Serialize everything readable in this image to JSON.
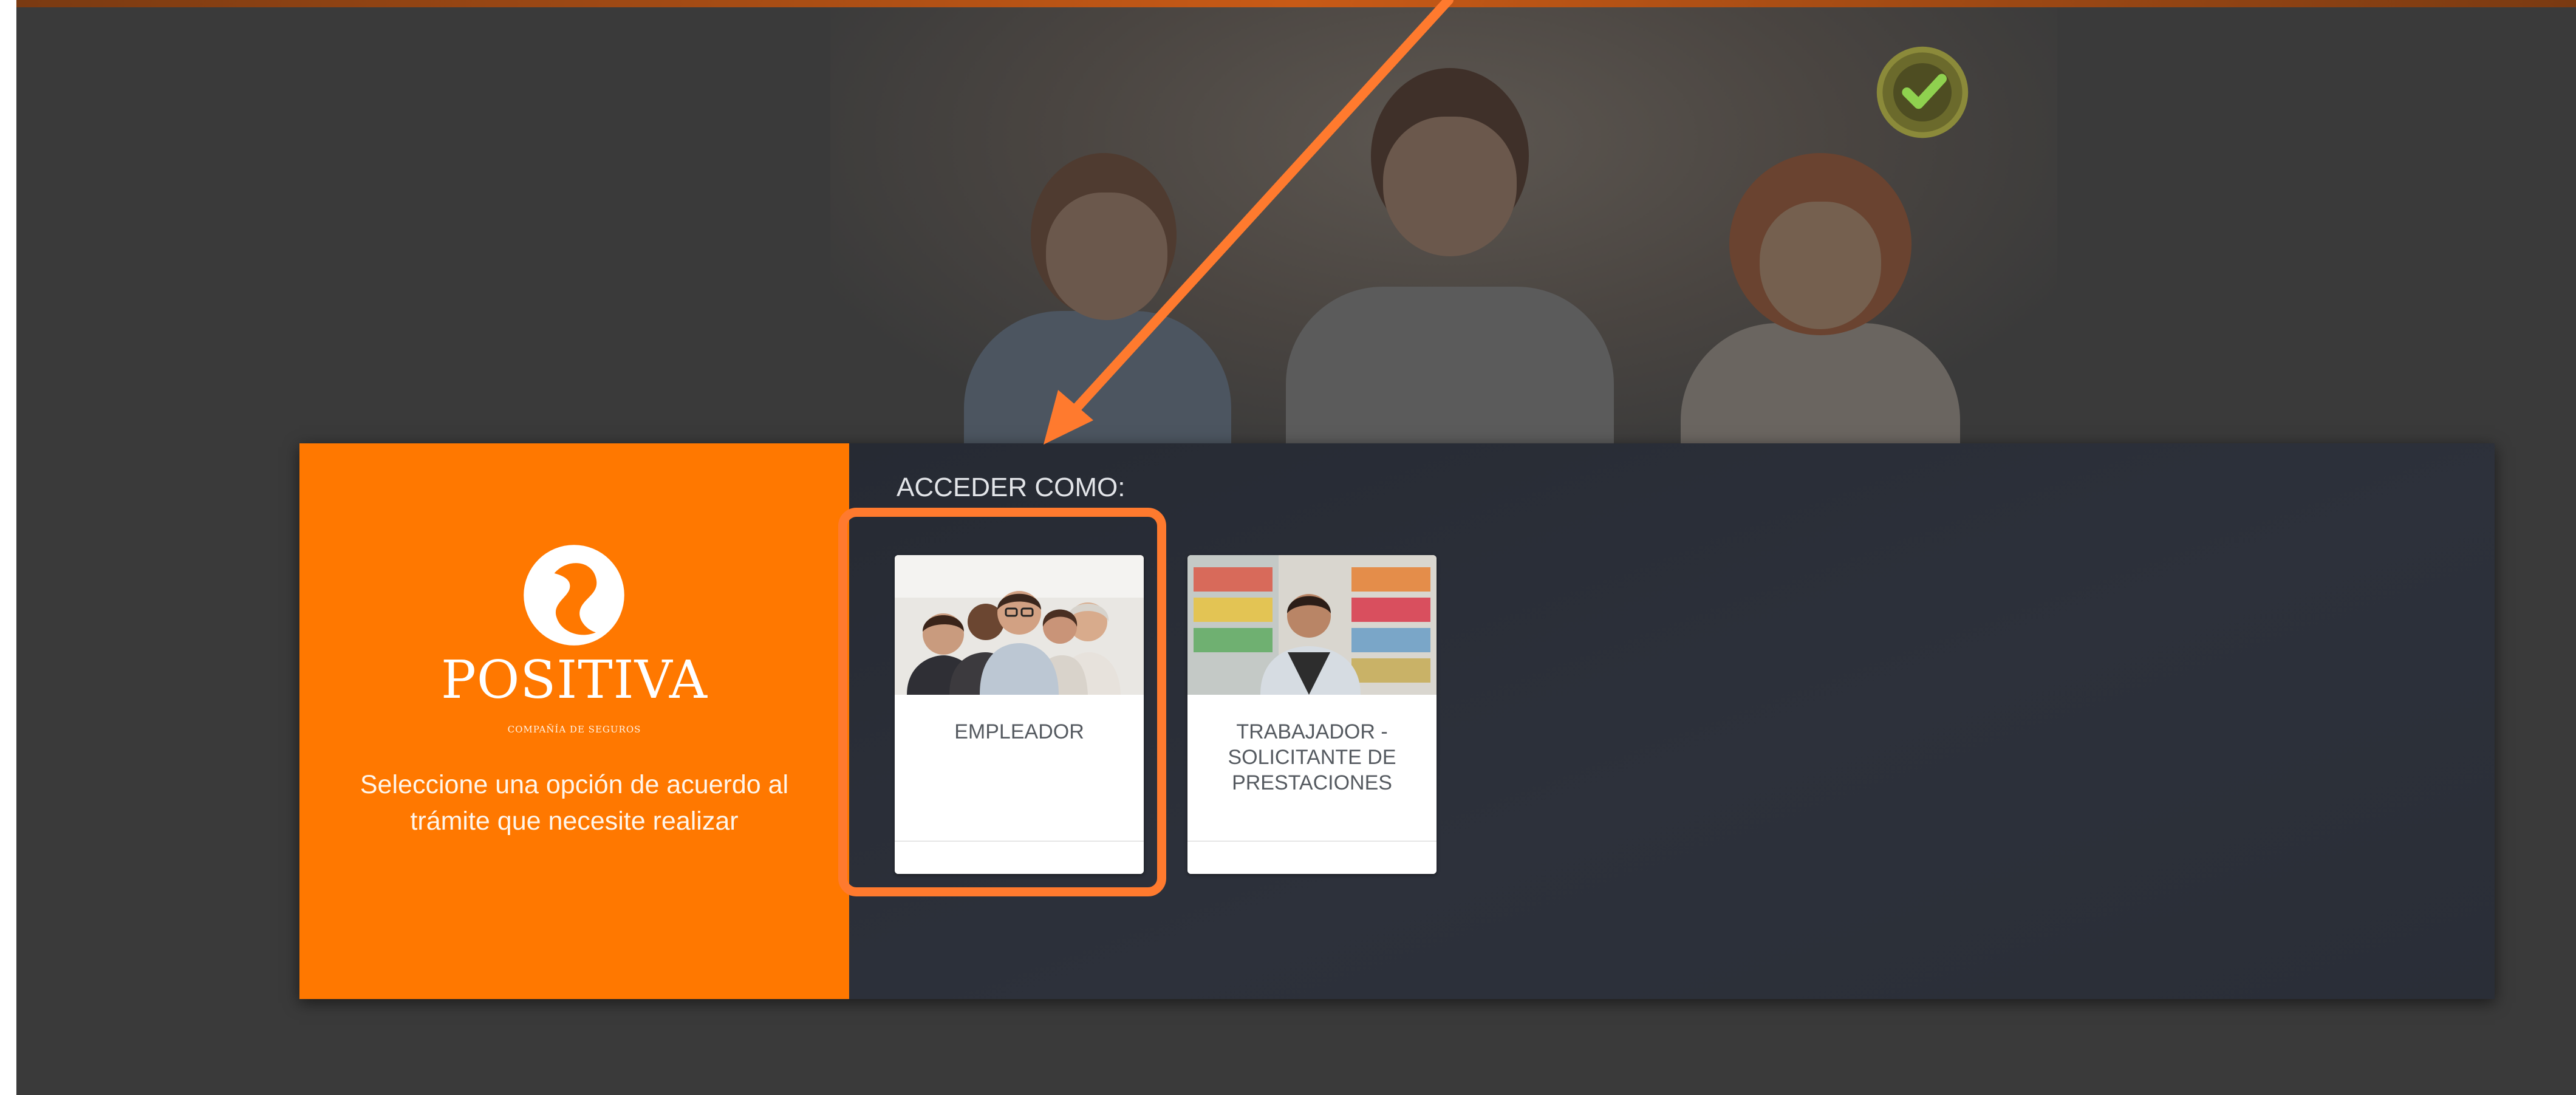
{
  "brand": {
    "name": "POSITIVA",
    "subtitle": "COMPAÑÍA DE SEGUROS",
    "logo": "positiva-swirl-logo",
    "color": "#ff7800"
  },
  "panel": {
    "message": "Seleccione una opción de acuerdo al trámite que necesite realizar",
    "access_title": "ACCEDER COMO:"
  },
  "cards": [
    {
      "label": "EMPLEADOR",
      "image": "group-of-employees-photo"
    },
    {
      "label": "TRABAJADOR - SOLICITANTE DE PRESTACIONES",
      "image": "shop-worker-photo"
    }
  ],
  "annotation": {
    "color": "#ff7a2e",
    "target": "EMPLEADOR",
    "shapes": [
      "arrow",
      "rounded-rectangle"
    ]
  },
  "background": {
    "image": "three-people-smiling-photo",
    "seal": "certification-check-seal",
    "colors": {
      "base": "#3a3a3a",
      "panel": "#262a33"
    }
  }
}
